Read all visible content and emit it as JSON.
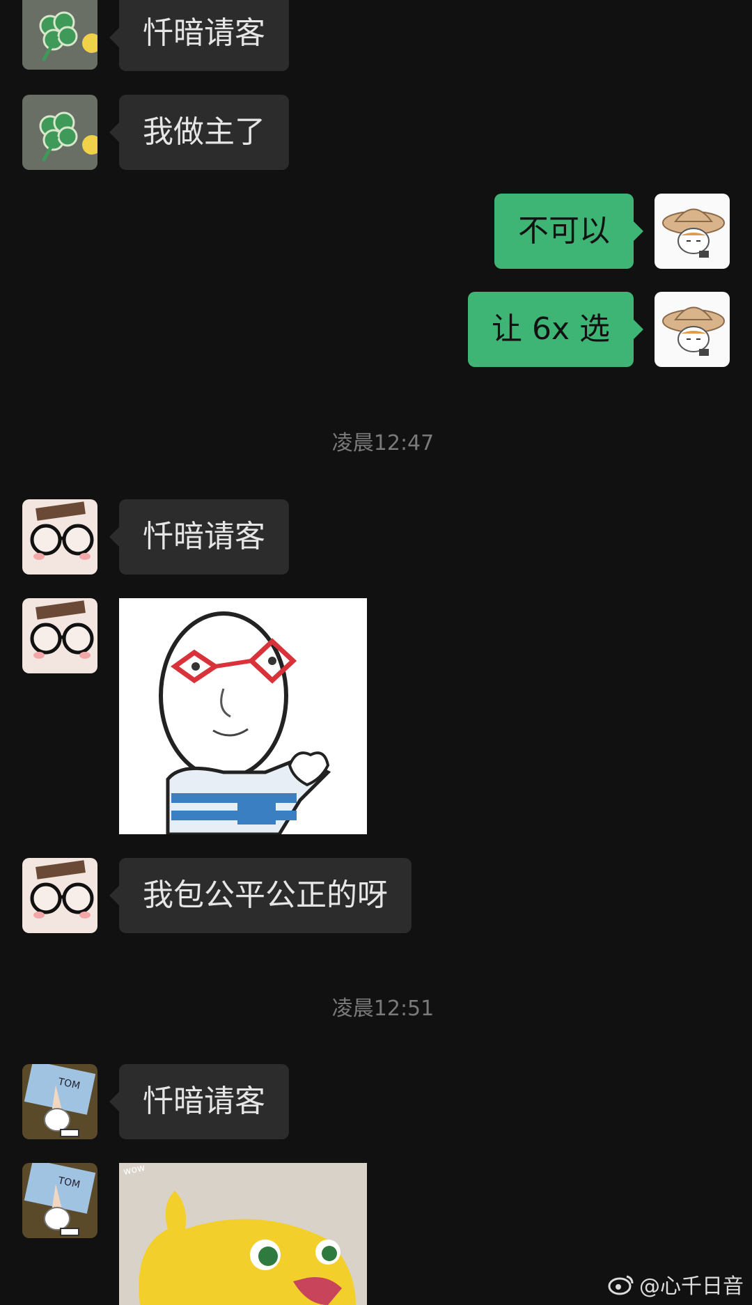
{
  "messages": {
    "m1": "忏暗请客",
    "m2": "我做主了",
    "m3": "不可以",
    "m4": "让 6x 选",
    "m5": "忏暗请客",
    "m6": "我包公平公正的呀",
    "m7": "忏暗请客"
  },
  "timestamps": {
    "t1": "凌晨12:47",
    "t2": "凌晨12:51"
  },
  "stickers": {
    "s2_caption": "wow"
  },
  "watermark": {
    "text": "@心千日音"
  },
  "colors": {
    "background": "#111111",
    "incoming_bubble": "#2c2c2c",
    "outgoing_bubble": "#3eb575",
    "timestamp": "#7a7a7a"
  },
  "icons": {
    "avatar1": "clover-avatar",
    "avatar2": "glasses-avatar",
    "avatar3": "diploma-dog-avatar",
    "self_avatar": "straw-hat-dog-avatar",
    "watermark_logo": "weibo-icon"
  }
}
